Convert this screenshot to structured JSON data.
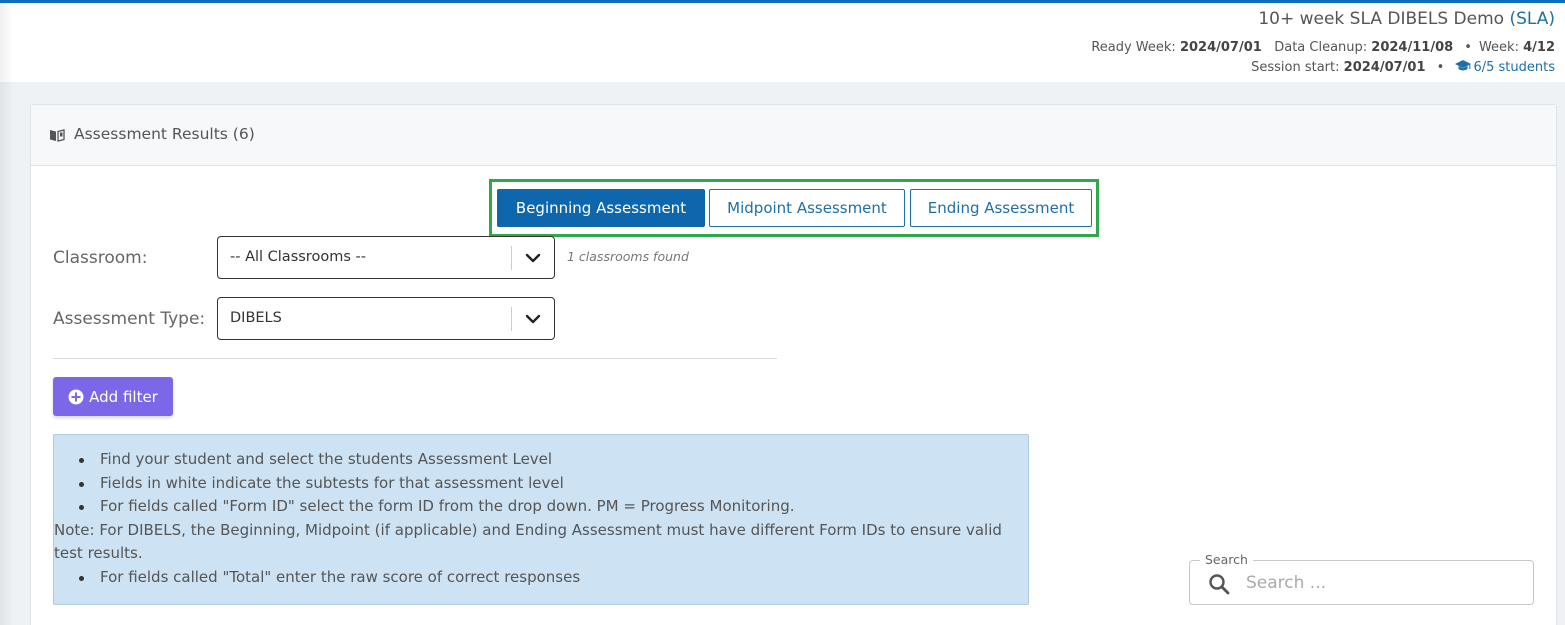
{
  "header": {
    "title": "10+ week SLA DIBELS Demo",
    "title_abbr": "(SLA)",
    "ready_week_label": "Ready Week:",
    "ready_week_value": "2024/07/01",
    "data_cleanup_label": "Data Cleanup:",
    "data_cleanup_value": "2024/11/08",
    "week_label": "Week:",
    "week_value": "4/12",
    "session_start_label": "Session start:",
    "session_start_value": "2024/07/01",
    "students_link": "6/5 students"
  },
  "card": {
    "title": "Assessment Results (6)",
    "icon": "book-icon"
  },
  "tabs": [
    {
      "label": "Beginning Assessment",
      "active": true
    },
    {
      "label": "Midpoint Assessment",
      "active": false
    },
    {
      "label": "Ending Assessment",
      "active": false
    }
  ],
  "filters": {
    "classroom_label": "Classroom:",
    "classroom_value": "-- All Classrooms --",
    "classroom_note": "1 classrooms found",
    "assessment_type_label": "Assessment Type:",
    "assessment_type_value": "DIBELS",
    "add_filter_label": "Add filter"
  },
  "instructions": {
    "items": [
      "Find your student and select the students Assessment Level",
      "Fields in white indicate the subtests for that assessment level",
      "For fields called \"Form ID\" select the form ID from the drop down. PM = Progress Monitoring."
    ],
    "note": "Note: For DIBELS, the Beginning, Midpoint (if applicable) and Ending Assessment must have different Form IDs to ensure valid test results.",
    "last_item": "For fields called \"Total\" enter the raw score of correct responses"
  },
  "search": {
    "legend": "Search",
    "placeholder": "Search ...",
    "value": ""
  },
  "colors": {
    "primary": "#0e66ad",
    "link": "#1e6fa6",
    "highlight_border": "#2ea84b",
    "add_filter": "#7b67e8",
    "info_bg": "#cde2f2"
  }
}
